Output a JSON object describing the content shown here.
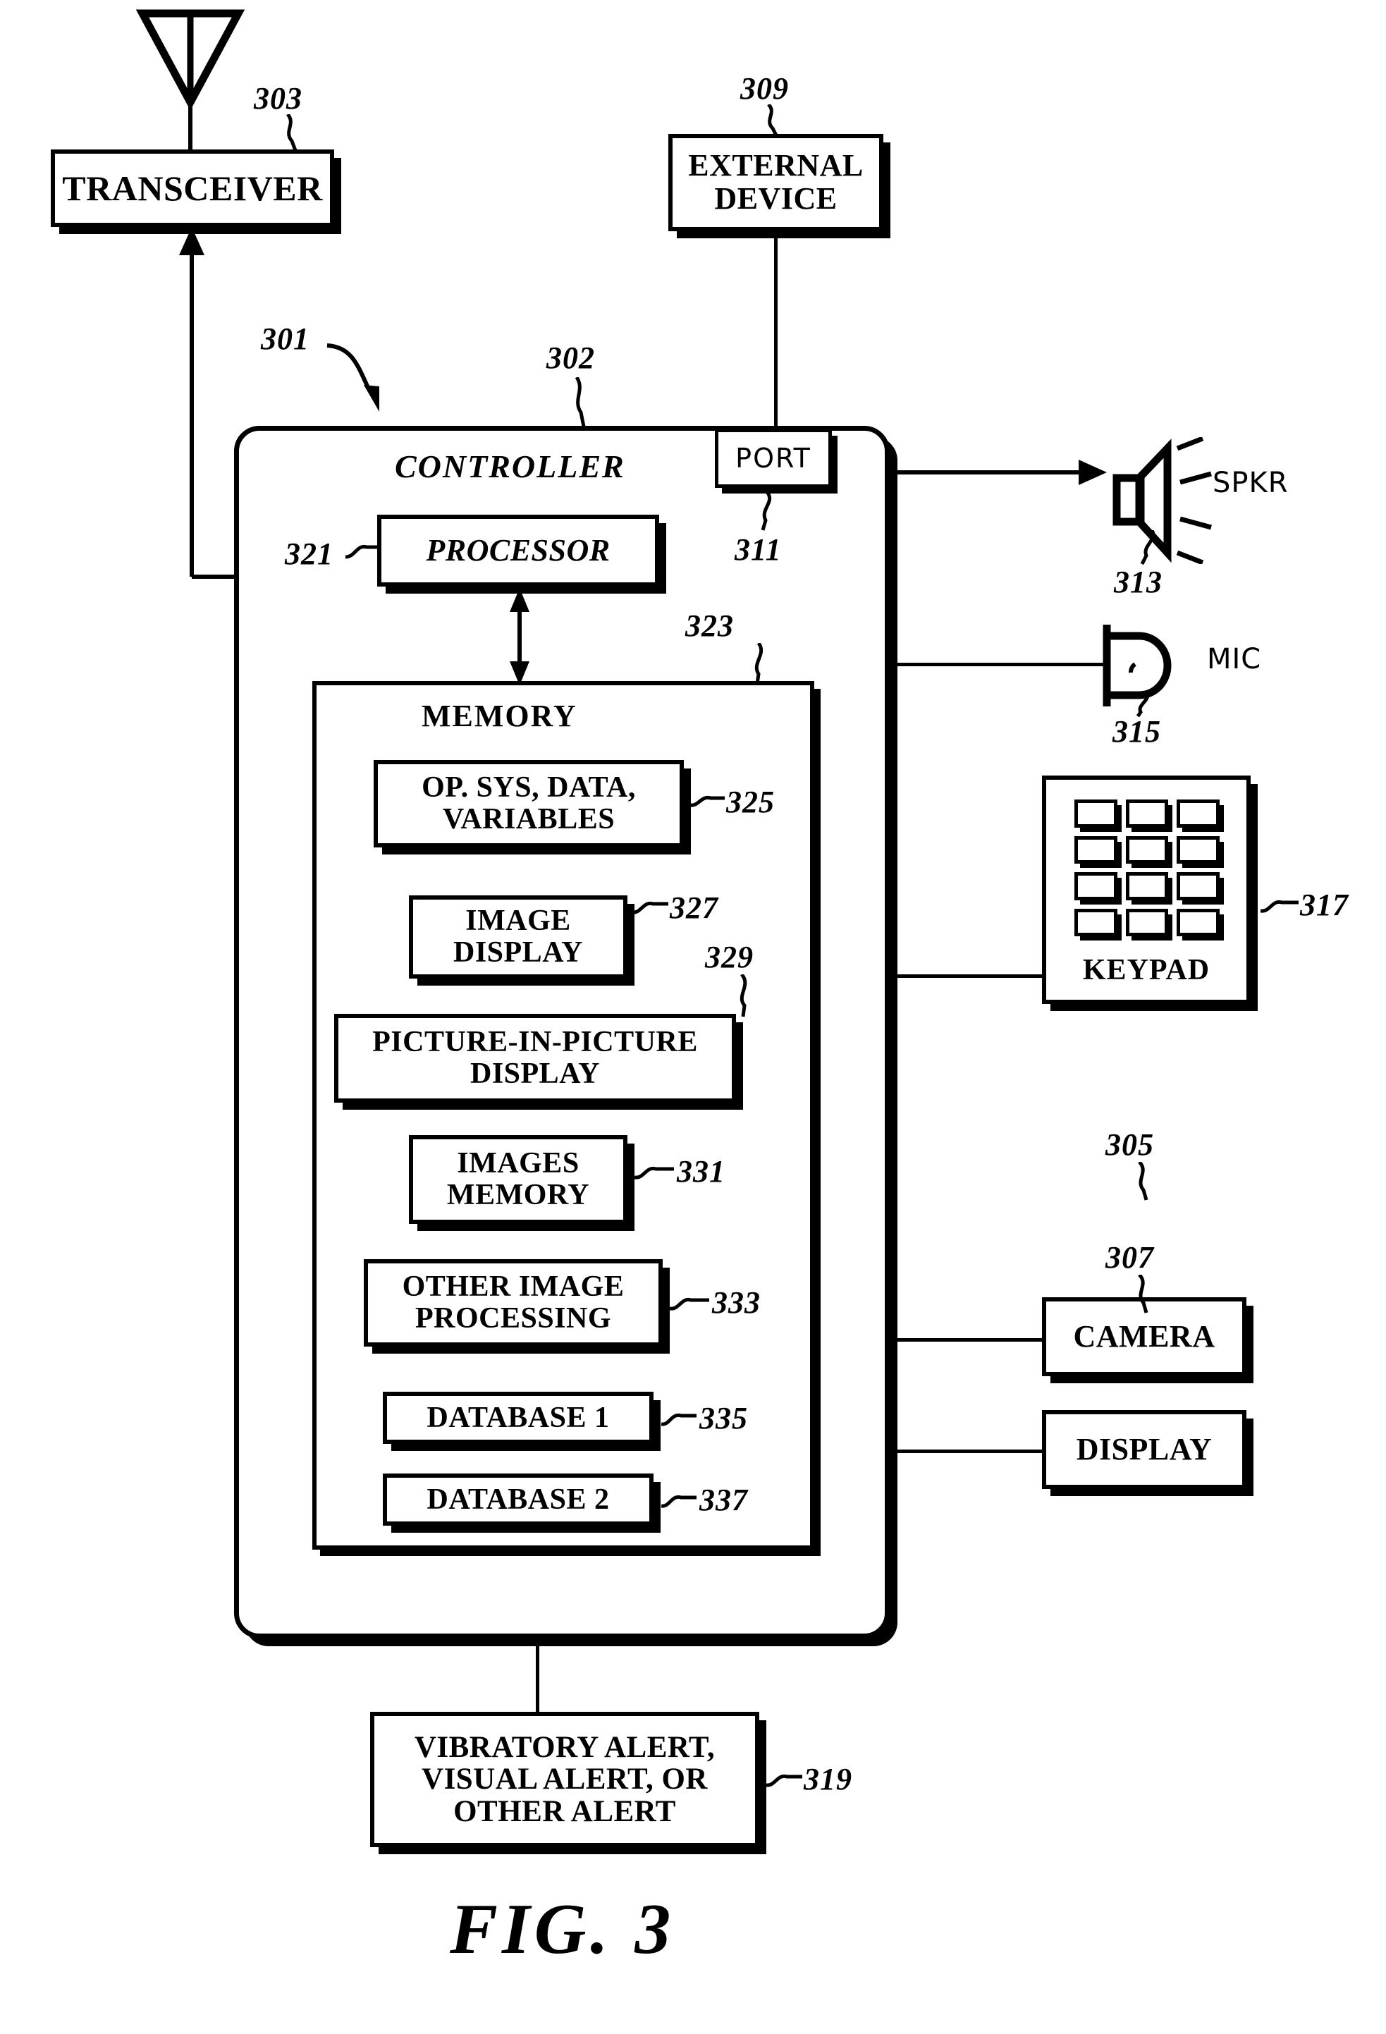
{
  "figure": {
    "caption": "FIG. 3",
    "numerals": {
      "n301": "301",
      "n302": "302",
      "n303": "303",
      "n305": "305",
      "n307": "307",
      "n309": "309",
      "n311": "311",
      "n313": "313",
      "n315": "315",
      "n317": "317",
      "n319": "319",
      "n321": "321",
      "n323": "323",
      "n325": "325",
      "n327": "327",
      "n329": "329",
      "n331": "331",
      "n333": "333",
      "n335": "335",
      "n337": "337"
    }
  },
  "blocks": {
    "transceiver": "TRANSCEIVER",
    "external_device": "EXTERNAL\nDEVICE",
    "external_device_line1": "EXTERNAL",
    "external_device_line2": "DEVICE",
    "controller": "CONTROLLER",
    "port": "PORT",
    "processor": "PROCESSOR",
    "memory": "MEMORY",
    "op_sys_line1": "OP. SYS, DATA,",
    "op_sys_line2": "VARIABLES",
    "image_display_line1": "IMAGE",
    "image_display_line2": "DISPLAY",
    "pip_line1": "PICTURE-IN-PICTURE",
    "pip_line2": "DISPLAY",
    "images_memory_line1": "IMAGES",
    "images_memory_line2": "MEMORY",
    "other_image_line1": "OTHER IMAGE",
    "other_image_line2": "PROCESSING",
    "database1": "DATABASE 1",
    "database2": "DATABASE 2",
    "keypad": "KEYPAD",
    "camera": "CAMERA",
    "display": "DISPLAY",
    "alert_line1": "VIBRATORY ALERT,",
    "alert_line2": "VISUAL ALERT, OR",
    "alert_line3": "OTHER ALERT",
    "speaker": "SPKR",
    "microphone": "MIC"
  },
  "icons": {
    "antenna": "antenna-icon",
    "speaker": "speaker-icon",
    "microphone": "microphone-icon",
    "keypad": "keypad-icon"
  },
  "colors": {
    "ink": "#000000",
    "paper": "#ffffff"
  }
}
